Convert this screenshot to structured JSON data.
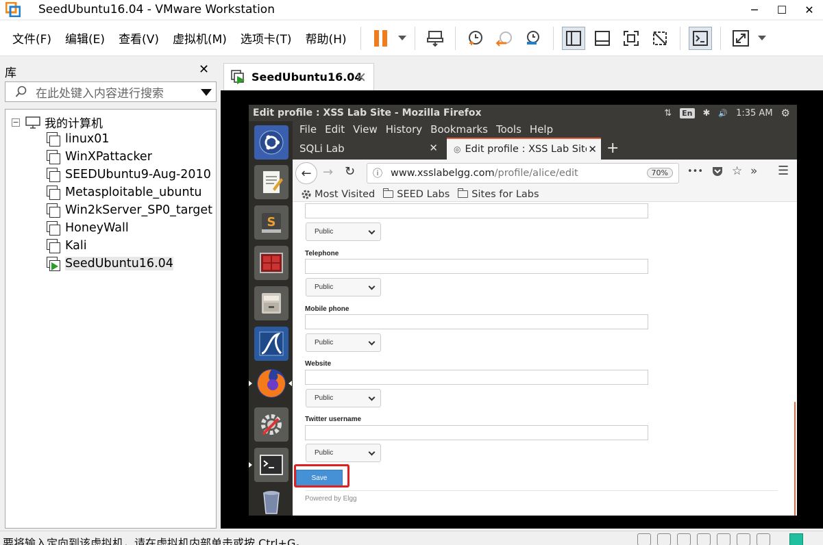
{
  "window": {
    "title": "SeedUbuntu16.04 - VMware Workstation",
    "controls": {
      "minimize": "─",
      "maximize": "☐",
      "close": "✕"
    }
  },
  "menu": {
    "items": [
      "文件(F)",
      "编辑(E)",
      "查看(V)",
      "虚拟机(M)",
      "选项卡(T)",
      "帮助(H)"
    ]
  },
  "colors": {
    "accent_orange": "#f07c1e",
    "ubuntu_panel": "#3b3a36",
    "launcher": "#2d2c28",
    "save_button": "#4690d6",
    "highlight_red": "#e02020",
    "firefox_tab_accent": "#e35e3e"
  },
  "library": {
    "header": "库",
    "close": "✕",
    "search_placeholder": "在此处键入内容进行搜索",
    "root": "我的计算机",
    "root_toggle": "−",
    "vms": [
      {
        "name": "linux01"
      },
      {
        "name": "WinXPattacker"
      },
      {
        "name": "SEEDUbuntu9-Aug-2010"
      },
      {
        "name": "Metasploitable_ubuntu"
      },
      {
        "name": "Win2kServer_SP0_target"
      },
      {
        "name": "HoneyWall"
      },
      {
        "name": "Kali"
      },
      {
        "name": "SeedUbuntu16.04",
        "selected": true,
        "running": true
      }
    ]
  },
  "vm_tab": {
    "label": "SeedUbuntu16.04",
    "close": "✕"
  },
  "ubuntu": {
    "window_title": "Edit profile : XSS Lab Site - Mozilla Firefox",
    "keyboard": "En",
    "time": "1:35 AM",
    "tray": {
      "network": "⇅",
      "bluetooth": "✱",
      "volume": "🔊",
      "gear": "⚙"
    }
  },
  "firefox": {
    "menu": [
      "File",
      "Edit",
      "View",
      "History",
      "Bookmarks",
      "Tools",
      "Help"
    ],
    "tabs": [
      {
        "title": "SQLi Lab",
        "close": "✕"
      },
      {
        "title": "Edit profile : XSS Lab Site",
        "close": "✕",
        "active": true
      }
    ],
    "new_tab": "+",
    "nav": {
      "back": "←",
      "forward": "→",
      "reload": "↻",
      "info": "ⓘ",
      "more": "•••",
      "overflow": "»",
      "menu": "☰",
      "star": "☆"
    },
    "url_host": "www.xsslabelgg.com",
    "url_path": "/profile/alice/edit",
    "zoom": "70%",
    "bookmarks": [
      "Most Visited",
      "SEED Labs",
      "Sites for Labs"
    ]
  },
  "form": {
    "fields": [
      {
        "label": "Telephone",
        "access": "Public"
      },
      {
        "label": "Mobile phone",
        "access": "Public"
      },
      {
        "label": "Website",
        "access": "Public"
      },
      {
        "label": "Twitter username",
        "access": "Public"
      }
    ],
    "first_access": "Public",
    "save_label": "Save",
    "footer": "Powered by Elgg"
  },
  "statusbar": {
    "message": "要将输入定向到该虚拟机，请在虚拟机内部单击或按 Ctrl+G。"
  }
}
